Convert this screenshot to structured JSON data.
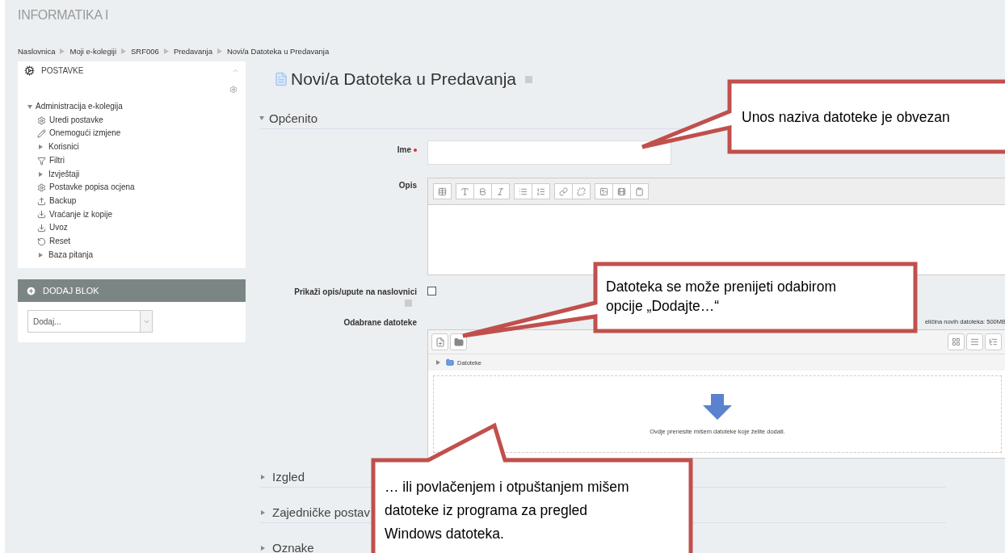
{
  "site_title": "INFORMATIKA I",
  "breadcrumb": [
    "Naslovnica",
    "Moji e-kolegiji",
    "SRF006",
    "Predavanja",
    "Novi/a Datoteka u Predavanja"
  ],
  "settings_block": {
    "title": "POSTAVKE",
    "tree": {
      "label": "Administracija e-kolegija",
      "expanded": true,
      "children": [
        {
          "label": "Uredi postavke",
          "kind": "gear"
        },
        {
          "label": "Onemogući izmjene",
          "kind": "pencil"
        },
        {
          "label": "Korisnici",
          "kind": "branch"
        },
        {
          "label": "Filtri",
          "kind": "filter"
        },
        {
          "label": "Izvještaji",
          "kind": "branch"
        },
        {
          "label": "Postavke popisa ocjena",
          "kind": "gear"
        },
        {
          "label": "Backup",
          "kind": "upload"
        },
        {
          "label": "Vraćanje iz kopije",
          "kind": "download"
        },
        {
          "label": "Uvoz",
          "kind": "download"
        },
        {
          "label": "Reset",
          "kind": "reset"
        },
        {
          "label": "Baza pitanja",
          "kind": "branch"
        }
      ]
    }
  },
  "add_block": {
    "title": "DODAJ BLOK",
    "select": {
      "value": "Dodaj..."
    }
  },
  "page_title": "Novi/a Datoteka u Predavanja",
  "general_section": {
    "title": "Općenito",
    "expanded": true
  },
  "name_field": {
    "label": "Ime",
    "required": true
  },
  "description_field": {
    "label": "Opis"
  },
  "show_description": {
    "label": "Prikaži opis/upute na naslovnici",
    "checked": false
  },
  "files_field": {
    "label": "Odabrane datoteke",
    "max_size": "eličina novih datoteka: 500MB",
    "folder": "Datoteke",
    "drop_hint": "Ovdje prenesite mišem datoteke koje želite dodati."
  },
  "collapsed_sections": [
    {
      "label": "Izgled",
      "expanded": false
    },
    {
      "label": "Zajedničke postav",
      "expanded": false
    },
    {
      "label": "Oznake",
      "expanded": false
    }
  ],
  "callouts": [
    {
      "text": "Unos naziva datoteke je obvezan"
    },
    {
      "text": "Datoteka se može prenijeti odabirom opcije „Dodajte…“"
    },
    {
      "text": "… ili povlačenjem i otpuštanjem mišem datoteke iz programa za pregled Windows datoteka."
    }
  ]
}
